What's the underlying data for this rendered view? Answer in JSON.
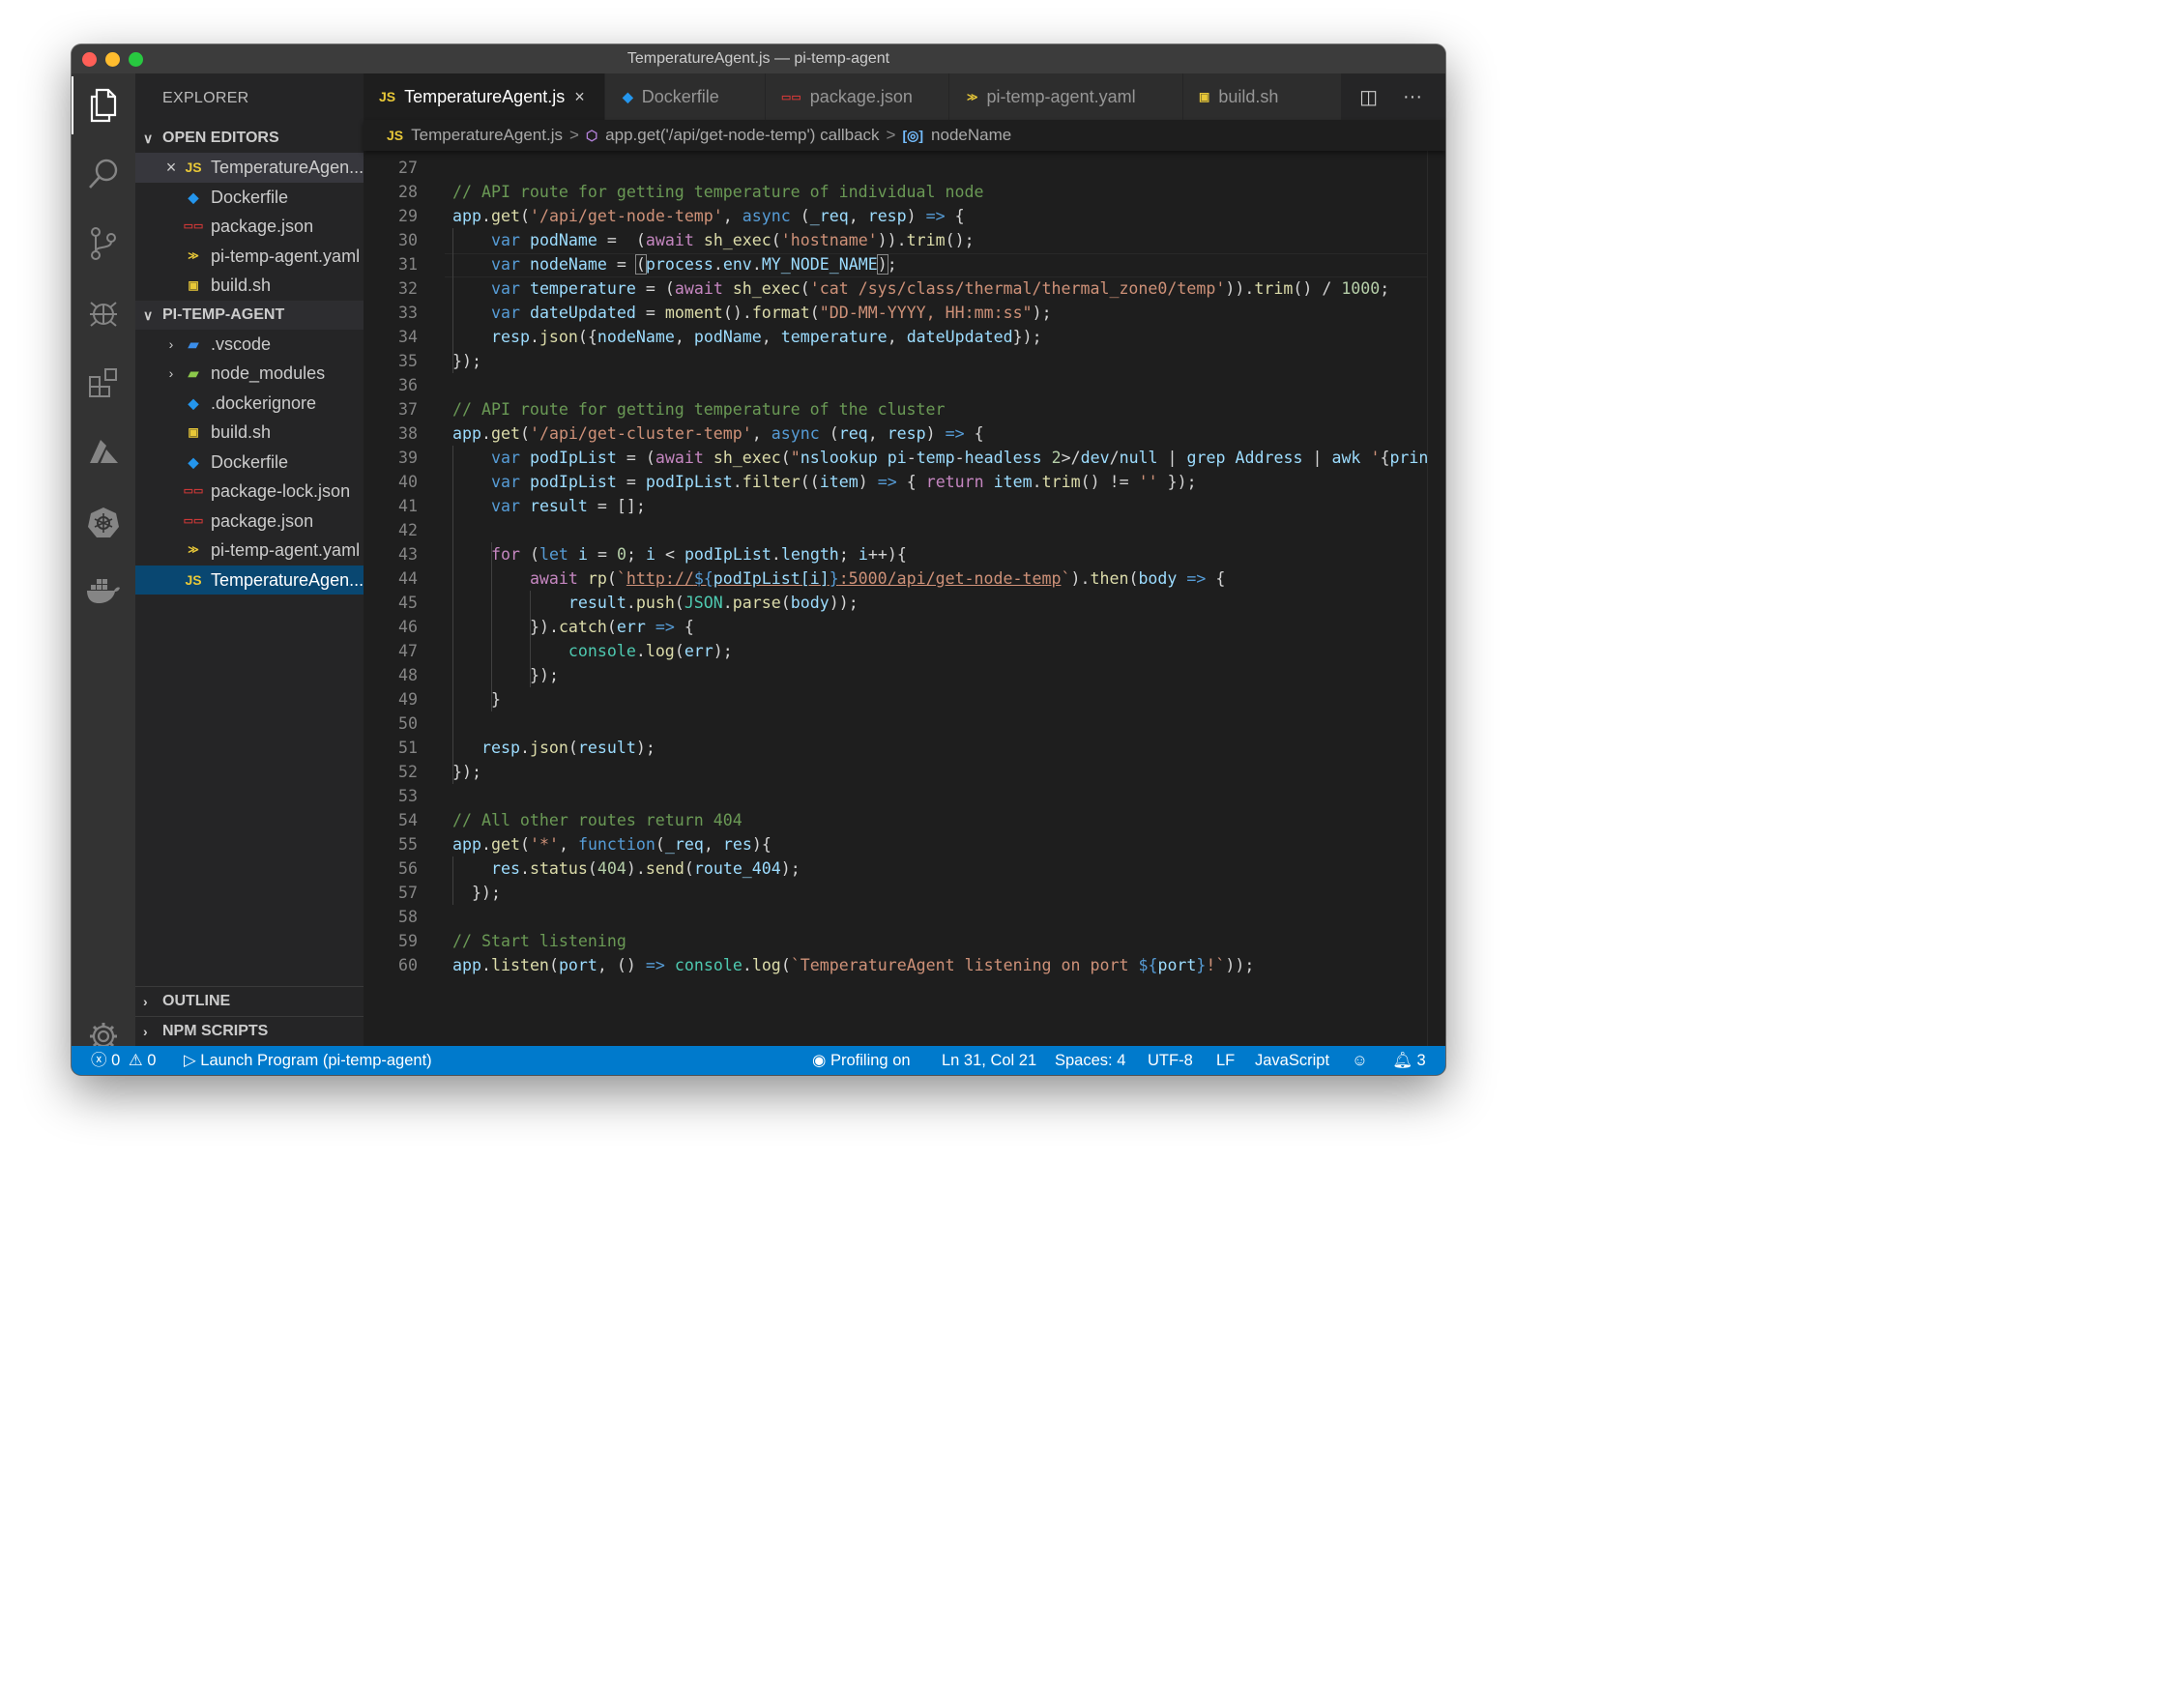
{
  "window": {
    "title": "TemperatureAgent.js — pi-temp-agent"
  },
  "sidebar": {
    "title": "EXPLORER",
    "open_editors": {
      "header": "OPEN EDITORS",
      "items": [
        {
          "icon": "JS",
          "label": "TemperatureAgen..."
        },
        {
          "icon": "docker-icon",
          "label": "Dockerfile"
        },
        {
          "icon": "npm-icon",
          "label": "package.json"
        },
        {
          "icon": "yaml-icon",
          "label": "pi-temp-agent.yaml"
        },
        {
          "icon": "shell-icon",
          "label": "build.sh"
        }
      ]
    },
    "project": {
      "header": "PI-TEMP-AGENT",
      "items": [
        {
          "label": ".vscode"
        },
        {
          "label": "node_modules"
        },
        {
          "label": ".dockerignore"
        },
        {
          "label": "build.sh"
        },
        {
          "label": "Dockerfile"
        },
        {
          "label": "package-lock.json"
        },
        {
          "label": "package.json"
        },
        {
          "label": "pi-temp-agent.yaml"
        },
        {
          "icon": "JS",
          "label": "TemperatureAgen..."
        }
      ]
    },
    "outline": "OUTLINE",
    "npm_scripts": "NPM SCRIPTS"
  },
  "tabs": [
    {
      "icon": "JS",
      "label": "TemperatureAgent.js",
      "close": "×"
    },
    {
      "label": "Dockerfile"
    },
    {
      "label": "package.json"
    },
    {
      "label": "pi-temp-agent.yaml"
    },
    {
      "label": "build.sh"
    }
  ],
  "tab_actions": {
    "split": "◫",
    "more": "···"
  },
  "breadcrumb": {
    "file_icon": "JS",
    "file": "TemperatureAgent.js",
    "sep": ">",
    "callback": "app.get('/api/get-node-temp') callback",
    "symbol": "nodeName"
  },
  "editor": {
    "cursor_line": "31",
    "lines": [
      {
        "n": "27",
        "code": ""
      },
      {
        "n": "28",
        "code": "// API route for getting temperature of individual node"
      },
      {
        "n": "29",
        "code": "app.get('/api/get-node-temp', async (_req, resp) => {"
      },
      {
        "n": "30",
        "code": "    var podName =  (await sh_exec('hostname')).trim();"
      },
      {
        "n": "31",
        "code": "    var nodeName = (process.env.MY_NODE_NAME);"
      },
      {
        "n": "32",
        "code": "    var temperature = (await sh_exec('cat /sys/class/thermal/thermal_zone0/temp')).trim() / 1000;"
      },
      {
        "n": "33",
        "code": "    var dateUpdated = moment().format(\"DD-MM-YYYY, HH:mm:ss\");"
      },
      {
        "n": "34",
        "code": "    resp.json({nodeName, podName, temperature, dateUpdated});"
      },
      {
        "n": "35",
        "code": "});"
      },
      {
        "n": "36",
        "code": ""
      },
      {
        "n": "37",
        "code": "// API route for getting temperature of the cluster"
      },
      {
        "n": "38",
        "code": "app.get('/api/get-cluster-temp', async (req, resp) => {"
      },
      {
        "n": "39",
        "code": "    var podIpList = (await sh_exec(\"nslookup pi-temp-headless 2>/dev/null | grep Address | awk '{print"
      },
      {
        "n": "40",
        "code": "    var podIpList = podIpList.filter((item) => { return item.trim() != '' });"
      },
      {
        "n": "41",
        "code": "    var result = [];"
      },
      {
        "n": "42",
        "code": ""
      },
      {
        "n": "43",
        "code": "    for (let i = 0; i < podIpList.length; i++){"
      },
      {
        "n": "44",
        "code": "        await rp(`http://${podIpList[i]}:5000/api/get-node-temp`).then(body => {"
      },
      {
        "n": "45",
        "code": "            result.push(JSON.parse(body));"
      },
      {
        "n": "46",
        "code": "        }).catch(err => {"
      },
      {
        "n": "47",
        "code": "            console.log(err);"
      },
      {
        "n": "48",
        "code": "        });"
      },
      {
        "n": "49",
        "code": "    }"
      },
      {
        "n": "50",
        "code": ""
      },
      {
        "n": "51",
        "code": "   resp.json(result);"
      },
      {
        "n": "52",
        "code": "});"
      },
      {
        "n": "53",
        "code": ""
      },
      {
        "n": "54",
        "code": "// All other routes return 404"
      },
      {
        "n": "55",
        "code": "app.get('*', function(_req, res){"
      },
      {
        "n": "56",
        "code": "    res.status(404).send(route_404);"
      },
      {
        "n": "57",
        "code": "  });"
      },
      {
        "n": "58",
        "code": ""
      },
      {
        "n": "59",
        "code": "// Start listening"
      },
      {
        "n": "60",
        "code": "app.listen(port, () => console.log(`TemperatureAgent listening on port ${port}!`));"
      }
    ]
  },
  "status": {
    "errors": "0",
    "warnings": "0",
    "launch": "Launch Program (pi-temp-agent)",
    "profiling": "Profiling on",
    "position": "Ln 31, Col 21",
    "spaces": "Spaces: 4",
    "encoding": "UTF-8",
    "eol": "LF",
    "language": "JavaScript",
    "notifications": "3"
  },
  "colors": {
    "status_bar": "#007acc",
    "selection": "#094771",
    "js_icon": "#e8c838",
    "docker_icon": "#2496ed",
    "npm_icon": "#cb3837"
  }
}
